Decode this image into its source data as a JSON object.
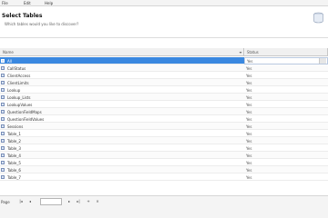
{
  "menu": [
    "File",
    "Edit",
    "Help"
  ],
  "header": {
    "title": "Select Tables",
    "subtitle": "Which tables would you like to discover?"
  },
  "table": {
    "columns": [
      "Name",
      "Status"
    ],
    "rows": [
      {
        "name": "All",
        "status": "Yes",
        "selected": true
      },
      {
        "name": "CallStatus",
        "status": "Yes"
      },
      {
        "name": "ClientAccess",
        "status": "Yes"
      },
      {
        "name": "ClientLimits",
        "status": "Yes"
      },
      {
        "name": "Lookup",
        "status": "Yes"
      },
      {
        "name": "Lookup_Lists",
        "status": "Yes"
      },
      {
        "name": "LookupValues",
        "status": "Yes"
      },
      {
        "name": "QuestionFieldMaps",
        "status": "Yes"
      },
      {
        "name": "QuestionFieldValues",
        "status": "Yes"
      },
      {
        "name": "Sessions",
        "status": "Yes"
      },
      {
        "name": "Table_1",
        "status": "Yes"
      },
      {
        "name": "Table_2",
        "status": "Yes"
      },
      {
        "name": "Table_3",
        "status": "Yes"
      },
      {
        "name": "Table_4",
        "status": "Yes"
      },
      {
        "name": "Table_5",
        "status": "Yes"
      },
      {
        "name": "Table_6",
        "status": "Yes"
      },
      {
        "name": "Table_7",
        "status": "Yes"
      }
    ]
  },
  "footer": {
    "page_label": "Page"
  },
  "colors": {
    "selection": "#3a88e0",
    "header_bg": "#f0f0f0"
  }
}
